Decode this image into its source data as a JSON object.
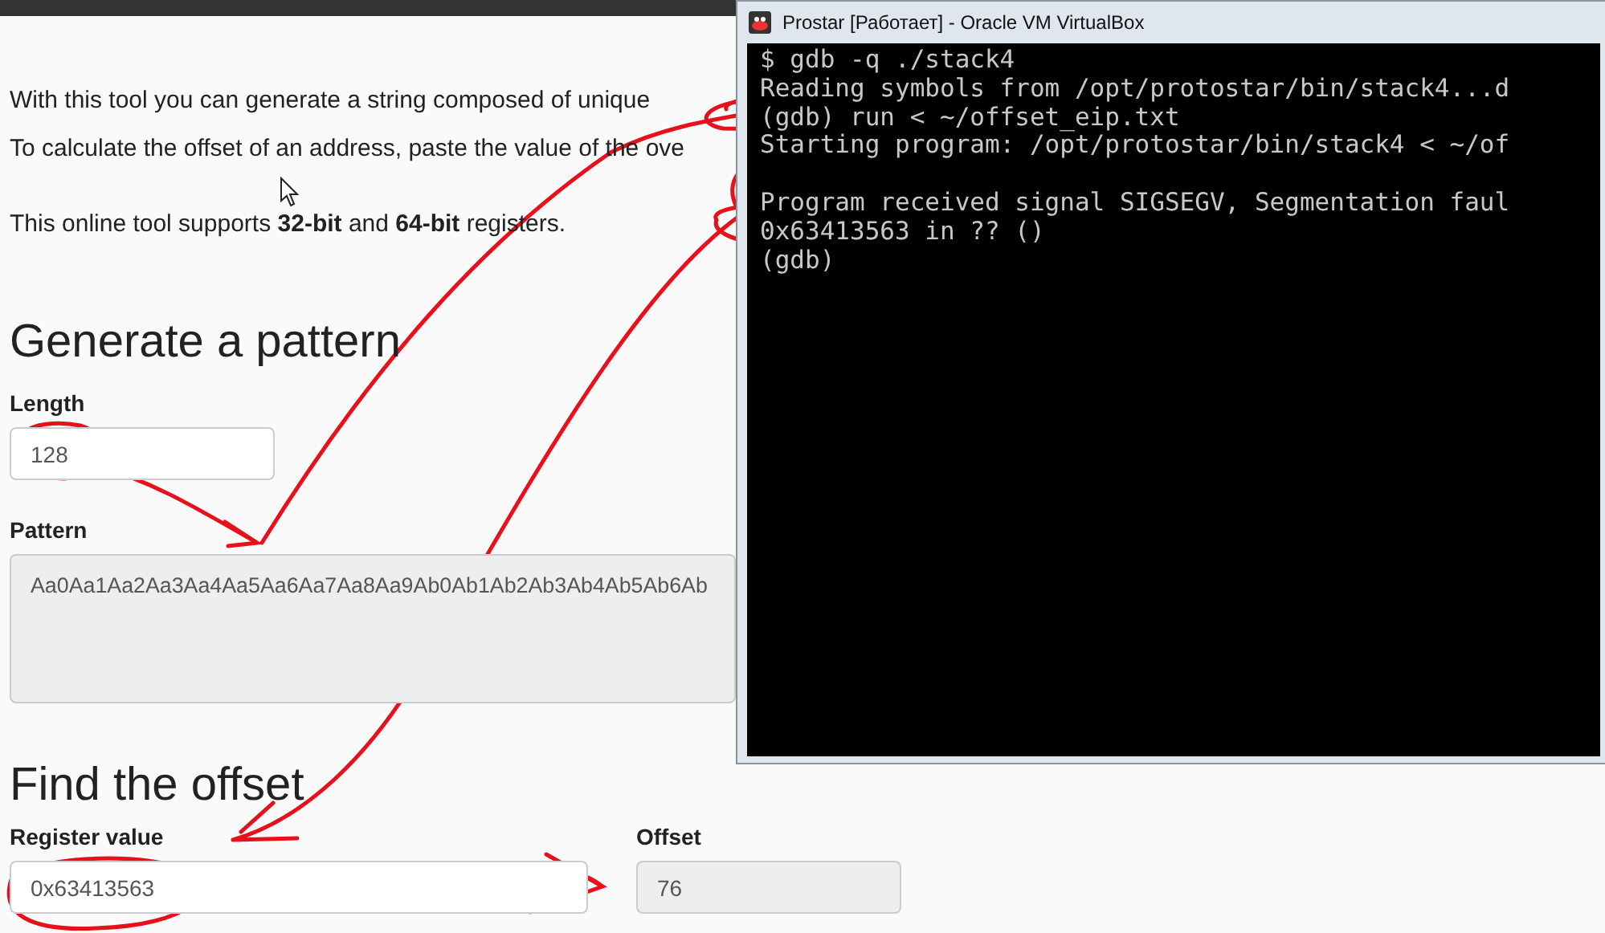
{
  "page": {
    "paragraphs": [
      "With this tool you can generate a string composed of unique",
      "To calculate the offset of an address, paste the value of the ove",
      "This online tool supports **32-bit** and **64-bit** registers."
    ],
    "generate": {
      "heading": "Generate a pattern",
      "length_label": "Length",
      "length_value": "128",
      "pattern_label": "Pattern",
      "pattern_value": "Aa0Aa1Aa2Aa3Aa4Aa5Aa6Aa7Aa8Aa9Ab0Ab1Ab2Ab3Ab4Ab5Ab6Ab"
    },
    "find": {
      "heading": "Find the offset",
      "register_label": "Register value",
      "register_value": "0x63413563",
      "offset_label": "Offset",
      "offset_value": "76"
    }
  },
  "vm_window": {
    "title": "Prostar [Работает] - Oracle VM VirtualBox",
    "terminal_lines": [
      "$ gdb -q ./stack4",
      "Reading symbols from /opt/protostar/bin/stack4...d",
      "(gdb) run < ~/offset_eip.txt",
      "Starting program: /opt/protostar/bin/stack4 < ~/of",
      "Program received signal SIGSEGV, Segmentation faul",
      "0x63413563 in ?? ()",
      "(gdb)"
    ]
  }
}
